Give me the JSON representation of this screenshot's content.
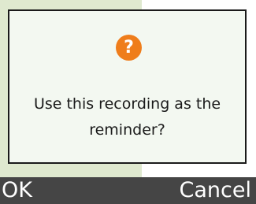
{
  "dialog": {
    "icon": "question-mark-icon",
    "icon_glyph": "?",
    "message": "Use this recording as the reminder?"
  },
  "softkeys": {
    "left_label": "OK",
    "right_label": "Cancel"
  },
  "colors": {
    "accent": "#ef7d1b",
    "dialog_bg": "#f3f8f1",
    "softkey_bar_bg": "#454545"
  }
}
